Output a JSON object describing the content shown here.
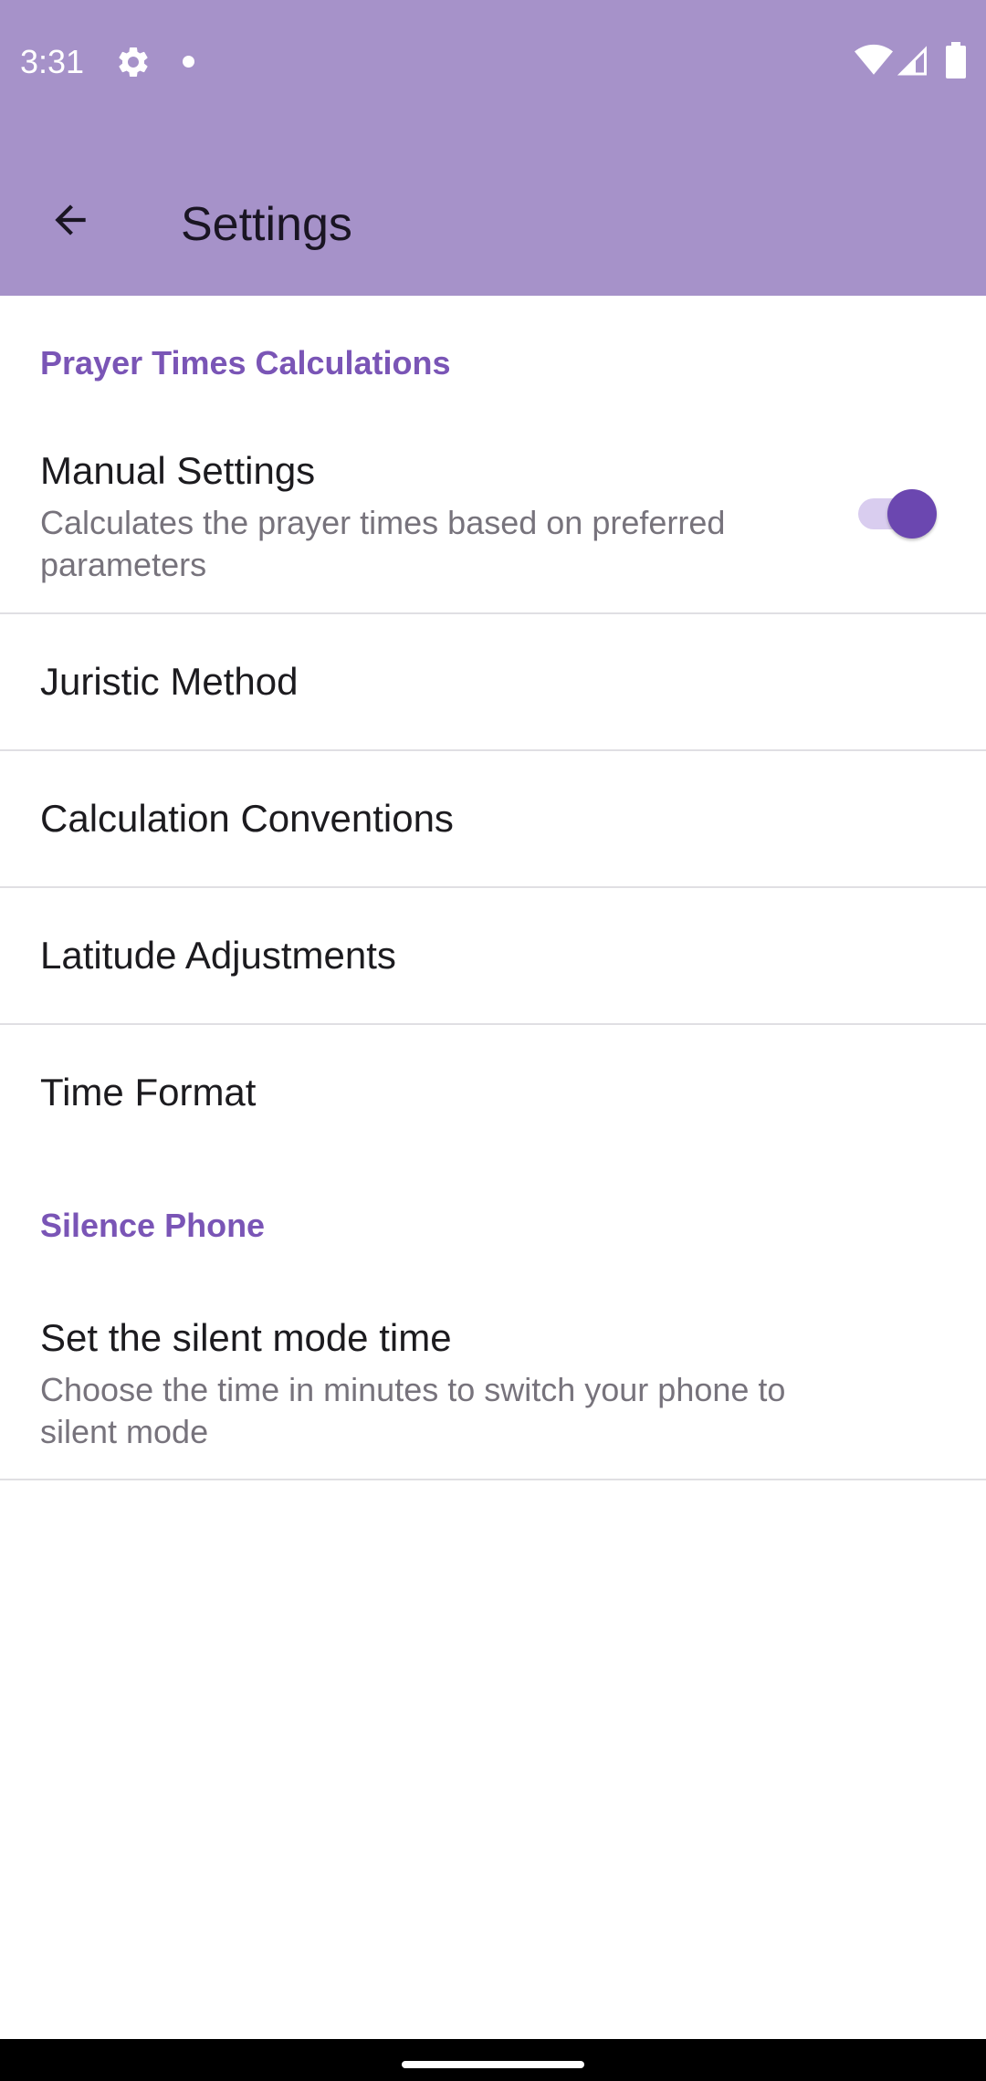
{
  "status_bar": {
    "time": "3:31",
    "icons": [
      "gear-icon",
      "notification-dot-icon",
      "wifi-icon",
      "cell-signal-icon",
      "battery-icon"
    ]
  },
  "app_bar": {
    "title": "Settings",
    "back_icon": "arrow-back-icon"
  },
  "colors": {
    "app_bar_background": "#a692c9",
    "category_accent": "#7a55b6",
    "switch_thumb": "#6b47b0",
    "switch_track": "#d9cdef"
  },
  "sections": [
    {
      "category": "Prayer Times Calculations",
      "preferences": [
        {
          "title": "Manual Settings",
          "summary": "Calculates the prayer times based on preferred parameters",
          "switch_on": true
        },
        {
          "title": "Juristic Method"
        },
        {
          "title": "Calculation Conventions"
        },
        {
          "title": "Latitude Adjustments"
        },
        {
          "title": "Time Format"
        }
      ]
    },
    {
      "category": "Silence Phone",
      "preferences": [
        {
          "title": "Set the silent mode time",
          "summary": "Choose the time in minutes to switch your phone to silent mode"
        }
      ]
    }
  ]
}
